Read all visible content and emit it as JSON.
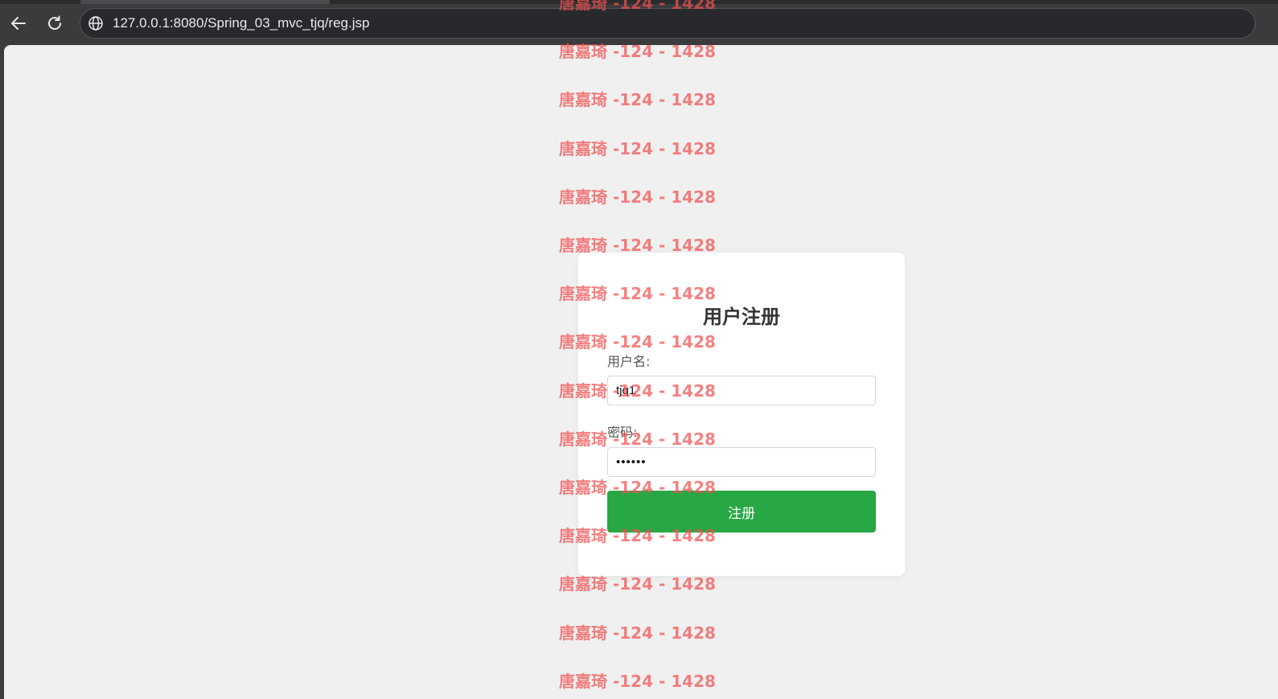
{
  "browser": {
    "url": "127.0.0.1:8080/Spring_03_mvc_tjq/reg.jsp"
  },
  "form": {
    "title": "用户注册",
    "username_label": "用户名:",
    "username_value": "tjq1",
    "password_label": "密码:",
    "password_value": "••••••",
    "submit_label": "注册"
  },
  "watermark": {
    "text": "唐嘉琦 -124 - 1428"
  },
  "colors": {
    "submit": "#28a745",
    "watermark": "#f05050"
  }
}
